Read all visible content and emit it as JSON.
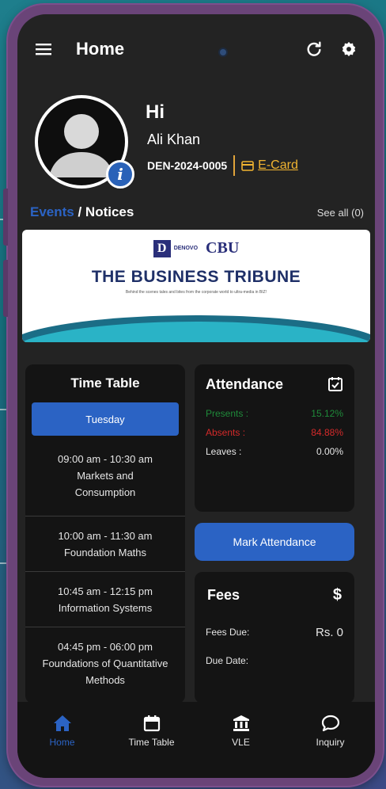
{
  "topbar": {
    "title": "Home",
    "menu_icon": "hamburger-icon",
    "refresh_icon": "refresh-icon",
    "settings_icon": "settings-icon"
  },
  "profile": {
    "greeting": "Hi",
    "name": "Ali Khan",
    "student_id": "DEN-2024-0005",
    "ecard_label": "E-Card",
    "ecard_icon": "id-card-icon"
  },
  "events": {
    "tab_events": "Events",
    "separator": " / ",
    "tab_notices": "Notices",
    "see_all": "See all (0)"
  },
  "banner": {
    "logo_left_mark": "D",
    "logo_left_text": "DENOVO",
    "logo_right": "CBU",
    "headline": "THE BUSINESS TRIBUNE",
    "tagline": "Behind the scenes tales and bites from the corporate world to ultra-media in BIZ!"
  },
  "timetable": {
    "title": "Time Table",
    "day": "Tuesday",
    "slots": [
      {
        "time": "09:00 am - 10:30 am",
        "subject": "Markets and Consumption"
      },
      {
        "time": "10:00 am - 11:30 am",
        "subject": "Foundation Maths"
      },
      {
        "time": "10:45 am - 12:15 pm",
        "subject": "Information Systems"
      },
      {
        "time": "04:45 pm - 06:00 pm",
        "subject": "Foundations of Quantitative Methods"
      }
    ]
  },
  "attendance": {
    "title": "Attendance",
    "present_label": "Presents :",
    "present_value": "15.12%",
    "absent_label": "Absents :",
    "absent_value": "84.88%",
    "leaves_label": "Leaves :",
    "leaves_value": "0.00%",
    "mark_button": "Mark Attendance"
  },
  "fees": {
    "title": "Fees",
    "currency_symbol": "$",
    "due_label": "Fees Due:",
    "due_value": "Rs. 0",
    "due_date_label": "Due Date:",
    "due_date_value": ""
  },
  "nav": {
    "items": [
      {
        "label": "Home",
        "icon": "home-icon"
      },
      {
        "label": "Time Table",
        "icon": "calendar-icon"
      },
      {
        "label": "VLE",
        "icon": "institution-icon"
      },
      {
        "label": "Inquiry",
        "icon": "chat-bubble-icon"
      }
    ]
  },
  "colors": {
    "accent": "#2b63c4",
    "present": "#1f8a3a",
    "absent": "#d42a2a",
    "ecard": "#f1b431",
    "frame": "#6a4478"
  }
}
